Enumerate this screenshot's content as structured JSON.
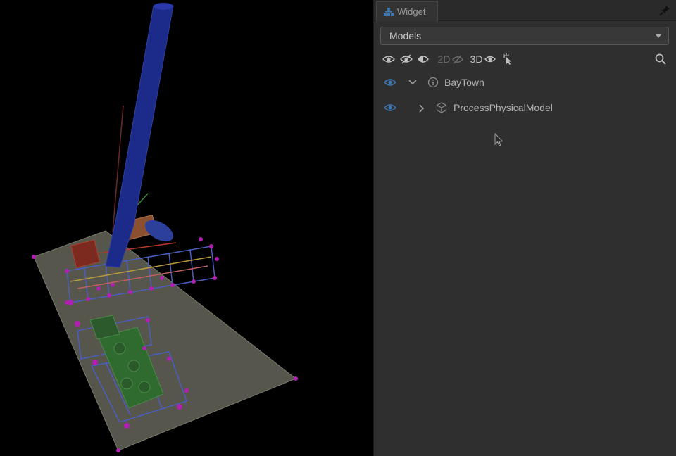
{
  "panel": {
    "tab_label": "Widget",
    "dropdown_value": "Models",
    "toolbar": {
      "label_2d": "2D",
      "label_3d": "3D"
    },
    "tree": [
      {
        "label": "BayTown",
        "expanded": true
      },
      {
        "label": "ProcessPhysicalModel",
        "expanded": false
      }
    ]
  },
  "colors": {
    "panel_bg": "#2f2f2f",
    "viewport_bg": "#000000",
    "eye_blue": "#3d78b5",
    "stack_blue": "#1c2a8a",
    "ground": "#5b5b50",
    "marker_magenta": "#b21fb2",
    "equipment_green": "#2f6a2f"
  },
  "icons": [
    "widget-tab-icon",
    "pin-icon",
    "eye-icon",
    "eye-off-icon",
    "half-eye-icon",
    "2d-eye-off-icon",
    "3d-eye-icon",
    "select-cursor-icon",
    "search-icon",
    "chevron-down-icon",
    "chevron-right-icon",
    "model-info-icon",
    "cube-icon"
  ]
}
